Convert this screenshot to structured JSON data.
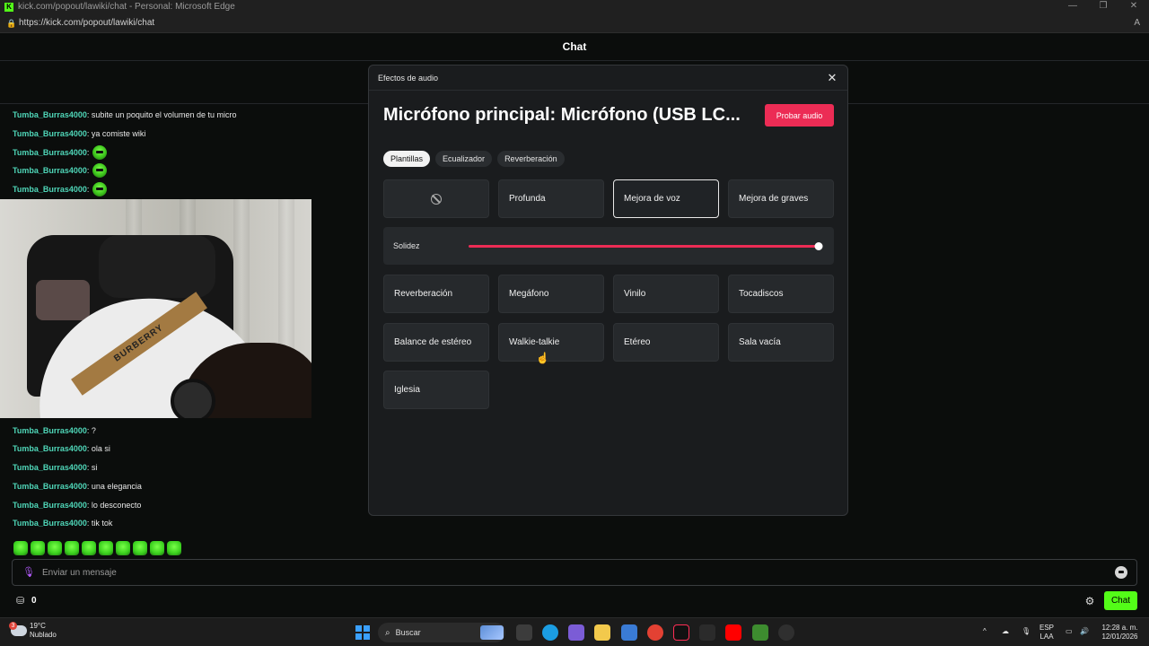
{
  "browser": {
    "window_title": "kick.com/popout/lawiki/chat - Personal: Microsoft Edge",
    "url": "https://kick.com/popout/lawiki/chat",
    "controls": [
      "—",
      "❐",
      "✕"
    ]
  },
  "chat": {
    "header_title": "Chat",
    "messages_top": [
      {
        "user": "Tumba_Burras4000",
        "text": ": subite un poquito el volumen de tu micro",
        "emote": false
      },
      {
        "user": "Tumba_Burras4000",
        "text": ": ya comiste wiki",
        "emote": false
      },
      {
        "user": "Tumba_Burras4000",
        "text": ":",
        "emote": true
      },
      {
        "user": "Tumba_Burras4000",
        "text": ":",
        "emote": true
      },
      {
        "user": "Tumba_Burras4000",
        "text": ":",
        "emote": true
      }
    ],
    "video_shirt_text": "BURBERRY",
    "messages_bottom": [
      {
        "user": "Tumba_Burras4000",
        "text": ": ?"
      },
      {
        "user": "Tumba_Burras4000",
        "text": ": ola si"
      },
      {
        "user": "Tumba_Burras4000",
        "text": ": si"
      },
      {
        "user": "Tumba_Burras4000",
        "text": ": una elegancia"
      },
      {
        "user": "Tumba_Burras4000",
        "text": ": lo desconecto"
      },
      {
        "user": "Tumba_Burras4000",
        "text": ": tik tok"
      }
    ],
    "emote_bar_count": 10,
    "input_placeholder": "Enviar un mensaje",
    "points": "0",
    "send_label": "Chat"
  },
  "modal": {
    "small_title": "Efectos de audio",
    "mic_title": "Micrófono principal: Micrófono (USB LC...",
    "test_button": "Probar audio",
    "tabs": [
      "Plantillas",
      "Ecualizador",
      "Reverberación"
    ],
    "active_tab": "Plantillas",
    "presets_row1": [
      "",
      "Profunda",
      "Mejora de voz",
      "Mejora de graves"
    ],
    "selected_preset": "Mejora de voz",
    "slider": {
      "label": "Solidez",
      "value_percent": 100
    },
    "presets_row2": [
      "Reverberación",
      "Megáfono",
      "Vinilo",
      "Tocadiscos"
    ],
    "presets_row3": [
      "Balance de estéreo",
      "Walkie-talkie",
      "Etéreo",
      "Sala vacía"
    ],
    "presets_row4": [
      "Iglesia"
    ],
    "accent_color": "#ec2c55"
  },
  "taskbar": {
    "weather_temp": "19°C",
    "weather_desc": "Nublado",
    "weather_badge": "3",
    "search_label": "Buscar",
    "lang_top": "ESP",
    "lang_bottom": "LAA",
    "time": "12:28 a. m.",
    "date": "12/01/2026"
  },
  "colors": {
    "kick_green": "#53fc18",
    "username": "#4fd6b8"
  }
}
